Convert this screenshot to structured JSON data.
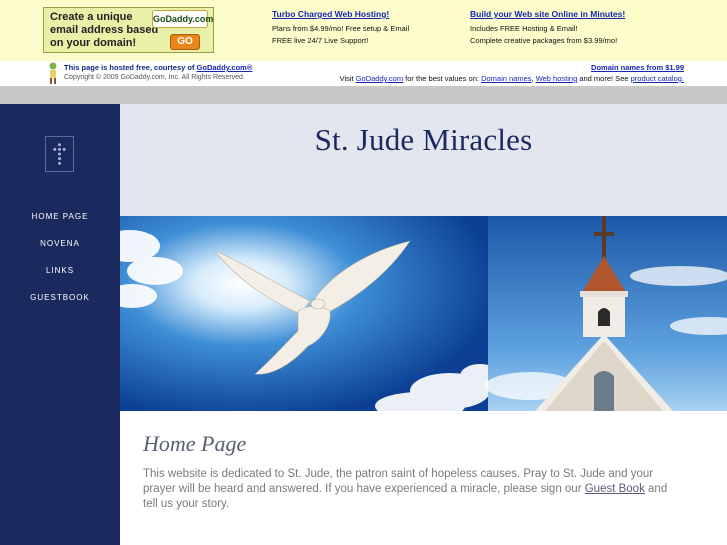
{
  "ad_banner": {
    "image_lines": [
      "Create a unique",
      "email address based",
      "on your domain!"
    ],
    "logo_text": "GoDaddy.com",
    "go_label": "GO",
    "col1": {
      "heading": "Turbo Charged Web Hosting!",
      "lines": [
        "Plans from $4.99/mo! Free setup & Email",
        "FREE live 24/7 Live Support!"
      ]
    },
    "col2": {
      "heading": "Build your Web site Online in Minutes!",
      "lines": [
        "Includes FREE Hosting & Email!",
        "Complete creative packages from $3.99/mo!"
      ]
    }
  },
  "host_bar": {
    "line1_prefix": "This page is hosted free, courtesy of ",
    "line1_link": "GoDaddy.com®",
    "line2": "Copyright © 2009 GoDaddy.com, Inc. All Rights Reserved.",
    "right1": "Domain names from $1.99",
    "right2_prefix": "Visit ",
    "right2_link1": "GoDaddy.com",
    "right2_mid": " for the best values on: ",
    "right2_link2": "Domain names",
    "right2_sep": ", ",
    "right2_link3": "Web hosting",
    "right2_mid2": " and more! See ",
    "right2_link4": "product catalog."
  },
  "sidebar": {
    "nav": [
      {
        "label": "HOME PAGE"
      },
      {
        "label": "NOVENA"
      },
      {
        "label": "LINKS"
      },
      {
        "label": "GUESTBOOK"
      }
    ]
  },
  "header": {
    "title": "St. Jude Miracles"
  },
  "content": {
    "title": "Home Page",
    "body_part1": "This website is dedicated to St. Jude, the patron saint of hopeless causes.  Pray to St. Jude and your prayer will be heard and answered.  If you have experienced a miracle, please sign our ",
    "body_link": "Guest Book",
    "body_part2": " and tell us your story."
  },
  "colors": {
    "sidebar_bg": "#1a2a5e",
    "header_bg": "#e3e6ef",
    "ad_bg": "#fdfdcb",
    "link": "#1626b3"
  }
}
